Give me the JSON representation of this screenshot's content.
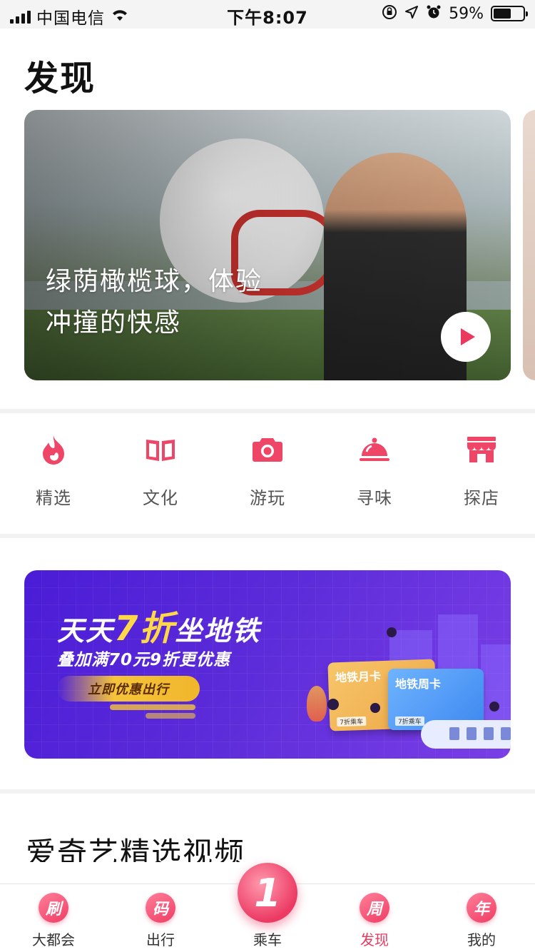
{
  "status_bar": {
    "carrier": "中国电信",
    "time": "下午8:07",
    "battery": "59%",
    "battery_level": 0.59,
    "icons": [
      "signal-icon",
      "wifi-icon",
      "orientation-lock-icon",
      "location-icon",
      "alarm-icon",
      "battery-icon"
    ]
  },
  "page": {
    "title": "发现"
  },
  "hero": {
    "caption_line1": "绿荫橄榄球，体验",
    "caption_line2": "冲撞的快感",
    "play_icon": "play-icon"
  },
  "categories": [
    {
      "label": "精选",
      "icon": "flame-icon"
    },
    {
      "label": "文化",
      "icon": "book-icon"
    },
    {
      "label": "游玩",
      "icon": "camera-icon"
    },
    {
      "label": "寻味",
      "icon": "cloche-icon"
    },
    {
      "label": "探店",
      "icon": "store-icon"
    }
  ],
  "promo": {
    "title_pre": "天天",
    "title_highlight": "7折",
    "title_post": "坐地铁",
    "subtitle": "叠加满70元9折更优惠",
    "button": "立即优惠出行",
    "card_month": "地铁月卡",
    "card_month_tag": "7折乘车",
    "card_week": "地铁周卡",
    "card_week_tag": "7折乘车"
  },
  "section": {
    "title": "爱奇艺精选视频"
  },
  "tabbar": {
    "active_color": "#e9395f",
    "items": [
      {
        "label": "大都会",
        "glyph": "刷"
      },
      {
        "label": "出行",
        "glyph": "码"
      },
      {
        "label": "乘车",
        "glyph": "1"
      },
      {
        "label": "发现",
        "glyph": "周"
      },
      {
        "label": "我的",
        "glyph": "年"
      }
    ]
  },
  "colors": {
    "accent": "#e9395f",
    "promo_bg": "#5b2bd9",
    "promo_highlight": "#ffd84a"
  }
}
